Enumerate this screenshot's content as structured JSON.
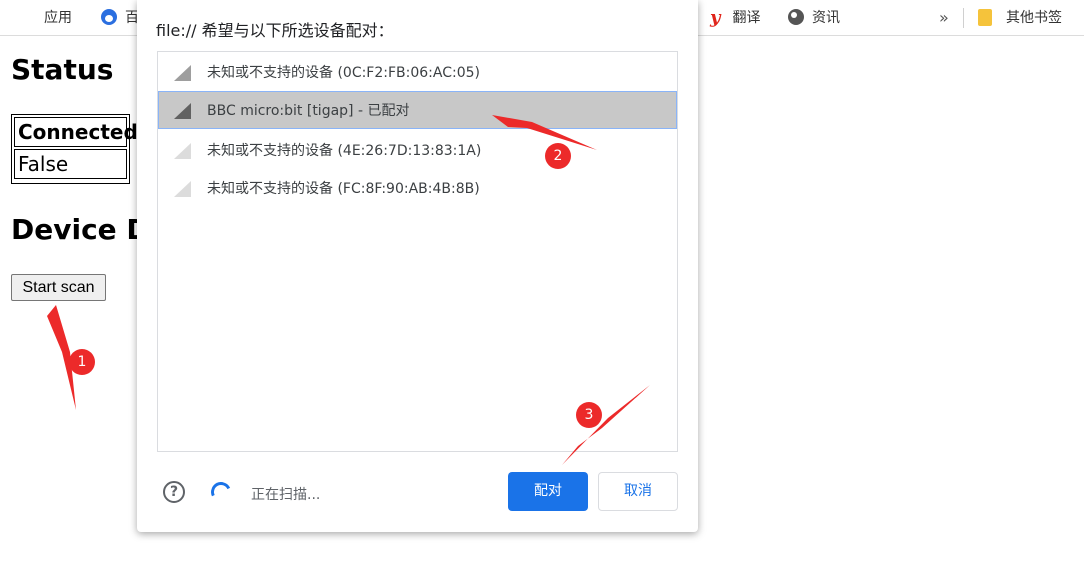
{
  "bookmarks": {
    "apps_label": "应用",
    "baidu_label": "百",
    "translate_label": "翻译",
    "news_label": "资讯",
    "more_label": "»",
    "other_bookmarks_label": "其他书签"
  },
  "page": {
    "status_heading": "Status",
    "table_header": "Connected",
    "table_value": "False",
    "device_heading": "Device D",
    "scan_button": "Start scan"
  },
  "dialog": {
    "title": "file:// 希望与以下所选设备配对：",
    "devices": [
      {
        "name": "未知或不支持的设备 (0C:F2:FB:06:AC:05)",
        "signal": "mid",
        "selected": false
      },
      {
        "name": "BBC micro:bit [tigap] - 已配对",
        "signal": "dark",
        "selected": true
      },
      {
        "name": "未知或不支持的设备 (4E:26:7D:13:83:1A)",
        "signal": "light",
        "selected": false
      },
      {
        "name": "未知或不支持的设备 (FC:8F:90:AB:4B:8B)",
        "signal": "light",
        "selected": false
      }
    ],
    "help_symbol": "?",
    "scanning_text": "正在扫描...",
    "pair_button": "配对",
    "cancel_button": "取消"
  },
  "annotations": {
    "step1": "1",
    "step2": "2",
    "step3": "3",
    "color": "#ec2a2a"
  },
  "colors": {
    "accent": "#1a73e8",
    "selection": "#c8c8c8",
    "annotation": "#ec2a2a"
  }
}
